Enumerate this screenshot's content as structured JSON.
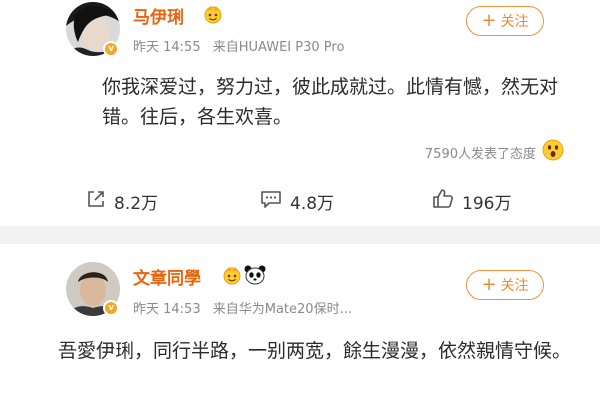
{
  "posts": [
    {
      "author": "马伊琍",
      "time": "昨天 14:55",
      "source": "来自HUAWEI P30 Pro",
      "follow_label": "关注",
      "content": "你我深爱过，努力过，彼此成就过。此情有憾，然无对错。往后，各生欢喜。",
      "reactions_text": "7590人发表了态度",
      "actions": {
        "share": "8.2万",
        "comment": "4.8万",
        "like": "196万"
      }
    },
    {
      "author": "文章同學",
      "time": "昨天 14:53",
      "source": "来自华为Mate20保时...",
      "follow_label": "关注",
      "content": "吾愛伊琍，同行半路，一别两宽，餘生漫漫，依然親情守候。"
    }
  ],
  "colors": {
    "accent": "#e8650e",
    "follow": "#f08a2e",
    "meta": "#8a8a8a",
    "divider": "#f2f2f2"
  }
}
